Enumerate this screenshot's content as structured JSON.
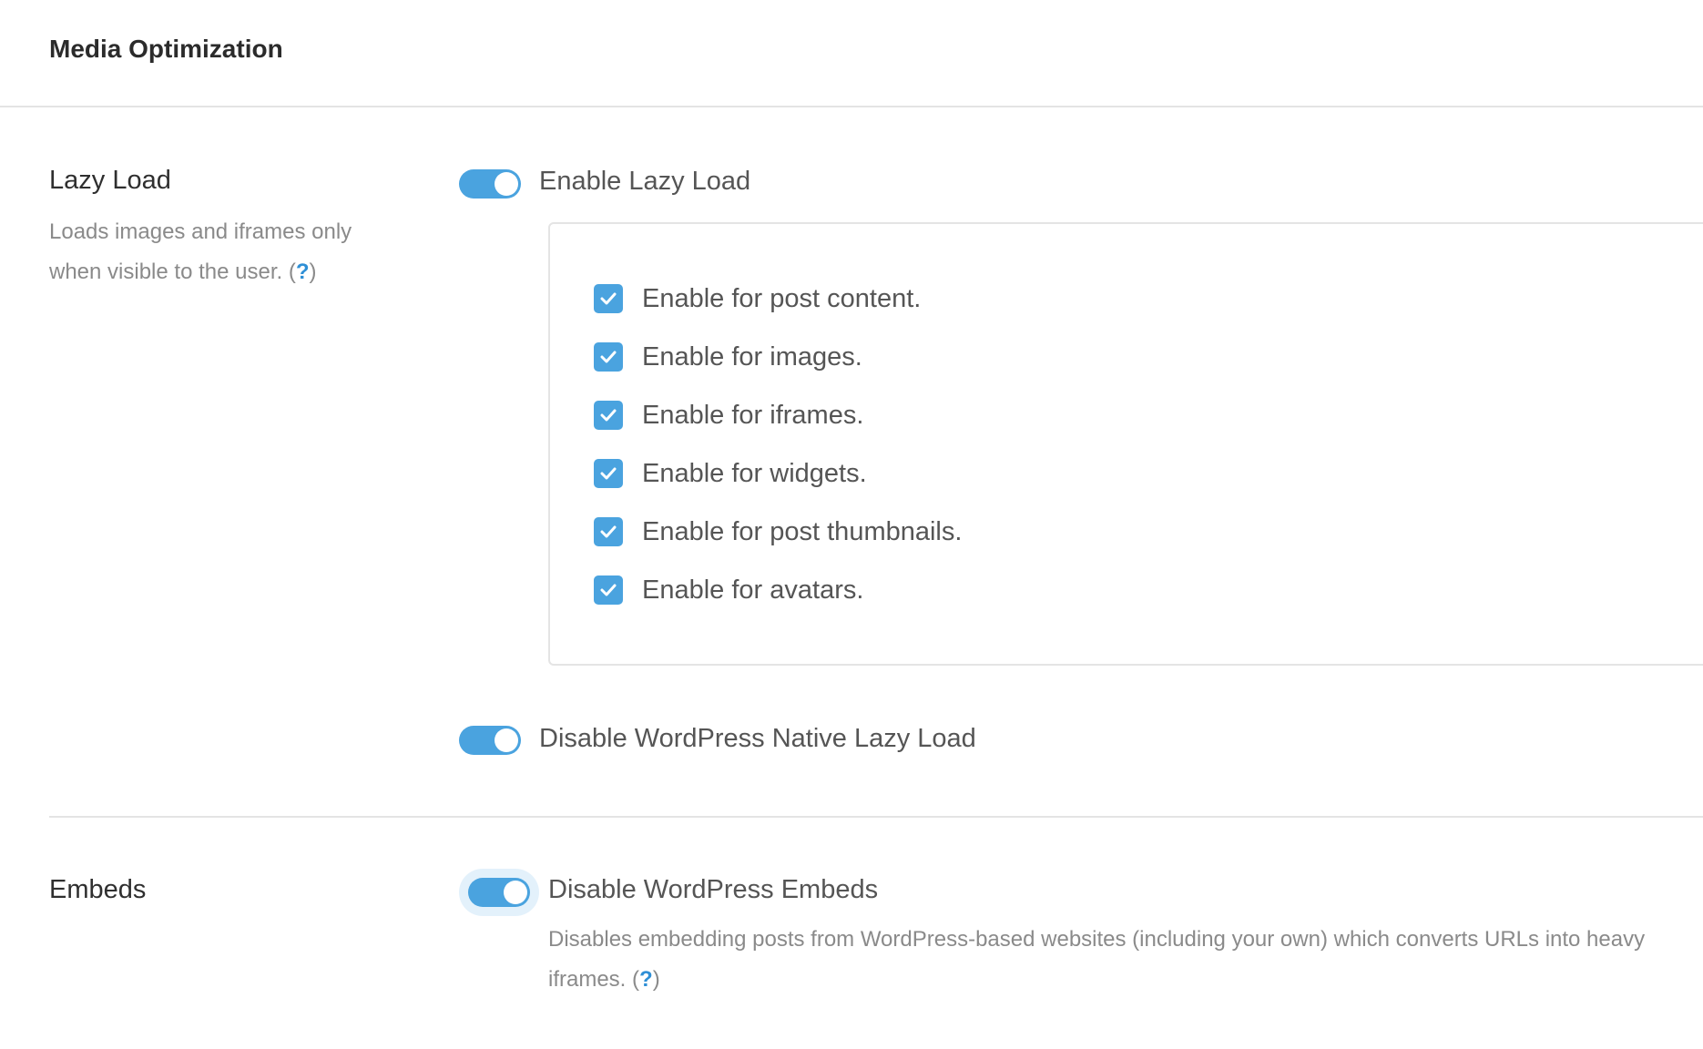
{
  "header": {
    "title": "Media Optimization"
  },
  "lazy_load": {
    "label": "Lazy Load",
    "description": "Loads images and iframes only when visible to the user.",
    "help_open": "(",
    "help_mark": "?",
    "help_close": ")",
    "enable_toggle": {
      "label": "Enable Lazy Load",
      "on": true
    },
    "options": [
      {
        "label": "Enable for post content.",
        "checked": true
      },
      {
        "label": "Enable for images.",
        "checked": true
      },
      {
        "label": "Enable for iframes.",
        "checked": true
      },
      {
        "label": "Enable for widgets.",
        "checked": true
      },
      {
        "label": "Enable for post thumbnails.",
        "checked": true
      },
      {
        "label": "Enable for avatars.",
        "checked": true
      }
    ],
    "native_toggle": {
      "label": "Disable WordPress Native Lazy Load",
      "on": true
    }
  },
  "embeds": {
    "label": "Embeds",
    "toggle": {
      "label": "Disable WordPress Embeds",
      "on": true
    },
    "description": "Disables embedding posts from WordPress-based websites (including your own) which converts URLs into heavy iframes.",
    "help_open": "(",
    "help_mark": "?",
    "help_close": ")"
  },
  "colors": {
    "accent": "#4aa3df",
    "help_link": "#2e8fd6",
    "divider": "#e4e4e4"
  }
}
